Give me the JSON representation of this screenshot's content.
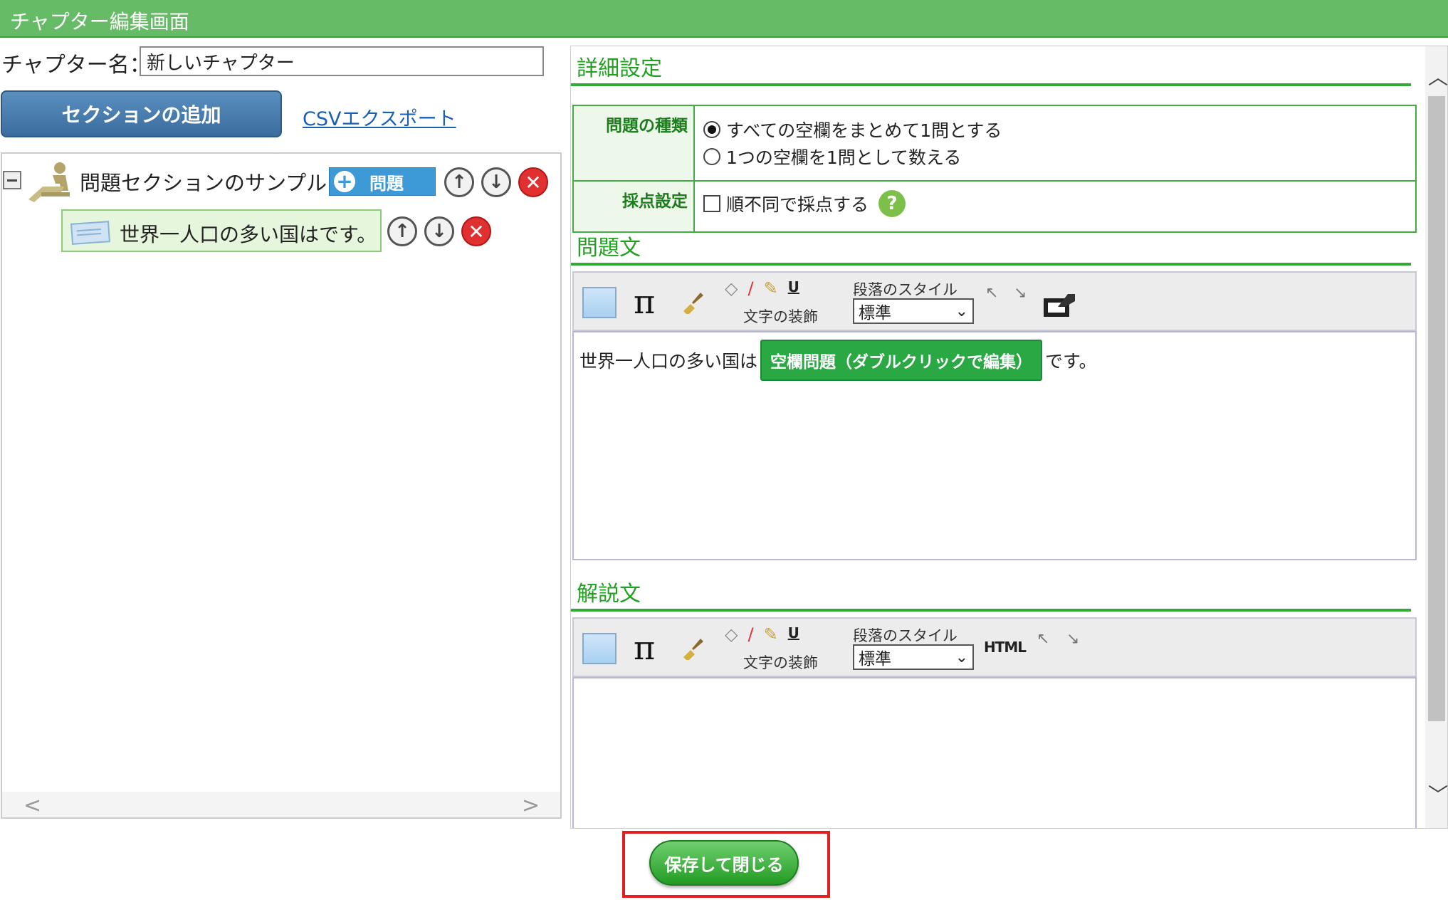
{
  "window": {
    "title": "チャプター編集画面"
  },
  "chapter": {
    "name_label": "チャプター名：",
    "name_value": "新しいチャプター"
  },
  "actions": {
    "add_section": "セクションの追加",
    "csv_export": "CSVエクスポート"
  },
  "tree": {
    "section_title": "問題セクションのサンプル",
    "add_question_label": "問題",
    "questions": [
      {
        "text": "世界一人口の多い国はです。"
      }
    ]
  },
  "settings": {
    "heading": "詳細設定",
    "question_type_label": "問題の種類",
    "question_type_options": [
      "すべての空欄をまとめて1問とする",
      "1つの空欄を1問として数える"
    ],
    "selected_question_type": 0,
    "scoring_label": "採点設定",
    "scoring_option": "順不同で採点する",
    "scoring_checked": false
  },
  "question_text": {
    "heading": "問題文",
    "before": "世界一人口の多い国は",
    "blank_chip": "空欄問題（ダブルクリックで編集）",
    "after": "です。"
  },
  "explanation": {
    "heading": "解説文"
  },
  "toolbar": {
    "decoration_label": "文字の装飾",
    "paragraph_label": "段落のスタイル",
    "paragraph_value": "標準",
    "underline": "U",
    "html_label": "HTML",
    "pi": "π"
  },
  "footer": {
    "save_close": "保存して閉じる"
  },
  "colors": {
    "title_bar": "#66bb66",
    "accent_green": "#33aa33",
    "primary_blue": "#3a6d9e",
    "delete_red": "#e03030",
    "highlight": "#e02020"
  }
}
